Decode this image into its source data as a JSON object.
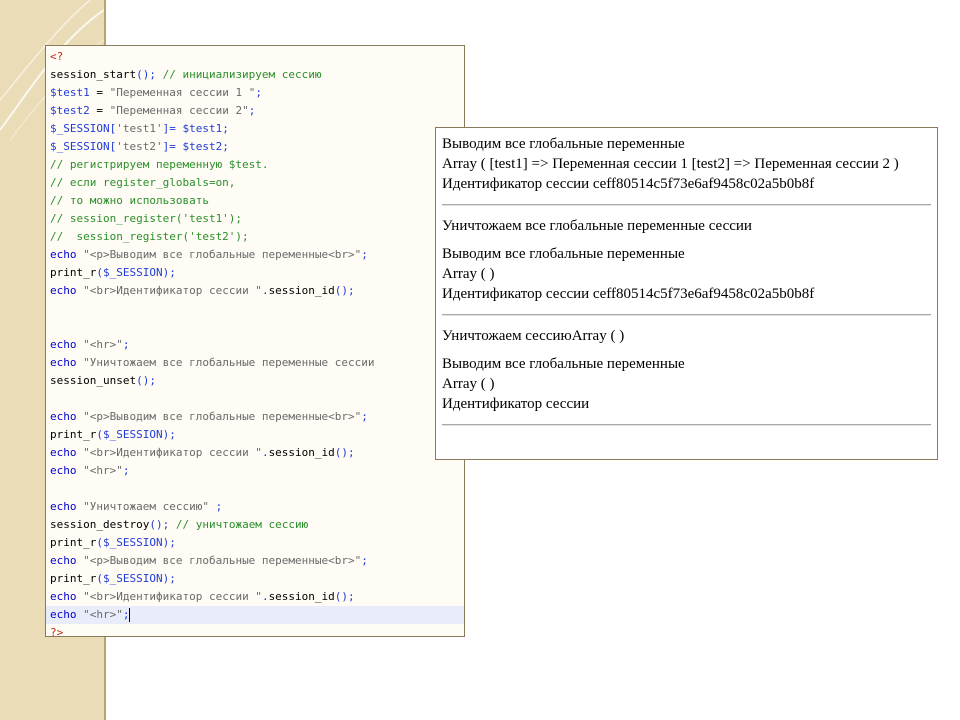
{
  "code": {
    "lines": [
      [
        [
          "tag",
          "<?"
        ]
      ],
      [
        [
          "fn",
          "session_start"
        ],
        [
          "pn",
          "();"
        ],
        [
          "com",
          " // инициализируем сессию"
        ]
      ],
      [
        [
          "var",
          "$test1"
        ],
        [
          "fn",
          " = "
        ],
        [
          "str",
          "\"Переменная сессии 1 \""
        ],
        [
          "pn",
          ";"
        ]
      ],
      [
        [
          "var",
          "$test2"
        ],
        [
          "fn",
          " = "
        ],
        [
          "str",
          "\"Переменная сессии 2\""
        ],
        [
          "pn",
          ";"
        ]
      ],
      [
        [
          "var",
          "$_SESSION"
        ],
        [
          "pn",
          "["
        ],
        [
          "str",
          "'test1'"
        ],
        [
          "pn",
          "]= "
        ],
        [
          "var",
          "$test1"
        ],
        [
          "pn",
          ";"
        ]
      ],
      [
        [
          "var",
          "$_SESSION"
        ],
        [
          "pn",
          "["
        ],
        [
          "str",
          "'test2'"
        ],
        [
          "pn",
          "]= "
        ],
        [
          "var",
          "$test2"
        ],
        [
          "pn",
          ";"
        ]
      ],
      [
        [
          "com",
          "// регистрируем переменную $test."
        ]
      ],
      [
        [
          "com",
          "// если register_globals=on,"
        ]
      ],
      [
        [
          "com",
          "// то можно использовать"
        ]
      ],
      [
        [
          "com",
          "// session_register('test1');"
        ]
      ],
      [
        [
          "com",
          "//  session_register('test2');"
        ]
      ],
      [
        [
          "kw",
          "echo"
        ],
        [
          "str",
          " \"<p>Выводим все глобальные переменные<br>\""
        ],
        [
          "pn",
          ";"
        ]
      ],
      [
        [
          "fn",
          "print_r"
        ],
        [
          "pn",
          "("
        ],
        [
          "var",
          "$_SESSION"
        ],
        [
          "pn",
          ");"
        ]
      ],
      [
        [
          "kw",
          "echo"
        ],
        [
          "str",
          " \"<br>Идентификатор сессии \""
        ],
        [
          "pn",
          "."
        ],
        [
          "fn",
          "session_id"
        ],
        [
          "pn",
          "();"
        ]
      ],
      [],
      [],
      [
        [
          "kw",
          "echo"
        ],
        [
          "str",
          " \"<hr>\""
        ],
        [
          "pn",
          ";"
        ]
      ],
      [
        [
          "kw",
          "echo"
        ],
        [
          "str",
          " \"Уничтожаем все глобальные переменные сессии"
        ]
      ],
      [
        [
          "fn",
          "session_unset"
        ],
        [
          "pn",
          "();"
        ]
      ],
      [],
      [
        [
          "kw",
          "echo"
        ],
        [
          "str",
          " \"<p>Выводим все глобальные переменные<br>\""
        ],
        [
          "pn",
          ";"
        ]
      ],
      [
        [
          "fn",
          "print_r"
        ],
        [
          "pn",
          "("
        ],
        [
          "var",
          "$_SESSION"
        ],
        [
          "pn",
          ");"
        ]
      ],
      [
        [
          "kw",
          "echo"
        ],
        [
          "str",
          " \"<br>Идентификатор сессии \""
        ],
        [
          "pn",
          "."
        ],
        [
          "fn",
          "session_id"
        ],
        [
          "pn",
          "();"
        ]
      ],
      [
        [
          "kw",
          "echo"
        ],
        [
          "str",
          " \"<hr>\""
        ],
        [
          "pn",
          ";"
        ]
      ],
      [],
      [
        [
          "kw",
          "echo"
        ],
        [
          "str",
          " \"Уничтожаем сессию\""
        ],
        [
          "pn",
          " ;"
        ]
      ],
      [
        [
          "fn",
          "session_destroy"
        ],
        [
          "pn",
          "();"
        ],
        [
          "com",
          " // уничтожаем сессию"
        ]
      ],
      [
        [
          "fn",
          "print_r"
        ],
        [
          "pn",
          "("
        ],
        [
          "var",
          "$_SESSION"
        ],
        [
          "pn",
          ");"
        ]
      ],
      [
        [
          "kw",
          "echo"
        ],
        [
          "str",
          " \"<p>Выводим все глобальные переменные<br>\""
        ],
        [
          "pn",
          ";"
        ]
      ],
      [
        [
          "fn",
          "print_r"
        ],
        [
          "pn",
          "("
        ],
        [
          "var",
          "$_SESSION"
        ],
        [
          "pn",
          ");"
        ]
      ],
      [
        [
          "kw",
          "echo"
        ],
        [
          "str",
          " \"<br>Идентификатор сессии \""
        ],
        [
          "pn",
          "."
        ],
        [
          "fn",
          "session_id"
        ],
        [
          "pn",
          "();"
        ]
      ],
      [
        [
          "kw",
          "echo"
        ],
        [
          "str",
          " \"<hr>\""
        ],
        [
          "pn",
          ";"
        ]
      ],
      [
        [
          "tag",
          "?>"
        ]
      ]
    ],
    "active_line": 31
  },
  "output": {
    "block1": {
      "heading": "Выводим все глобальные переменные",
      "array": "Array ( [test1] => Переменная сессии 1 [test2] => Переменная сессии 2 )",
      "session_id": "Идентификатор сессии ceff80514c5f73e6af9458c02a5b0b8f"
    },
    "destroy_vars": "Уничтожаем все глобальные переменные сессии",
    "block2": {
      "heading": "Выводим все глобальные переменные",
      "array": "Array ( )",
      "session_id": "Идентификатор сессии ceff80514c5f73e6af9458c02a5b0b8f"
    },
    "destroy_session": "Уничтожаем сессиюArray ( )",
    "block3": {
      "heading": "Выводим все глобальные переменные",
      "array": "Array ( )",
      "session_id": "Идентификатор сессии"
    }
  },
  "colors": {
    "slide_band": "#e9dcb6",
    "editor_bg": "#fffcf5",
    "keyword": "#0000cc",
    "comment": "#2a8f2a",
    "string": "#6a6a6a",
    "variable": "#1f3bd6",
    "php_tag": "#c22a1a"
  }
}
